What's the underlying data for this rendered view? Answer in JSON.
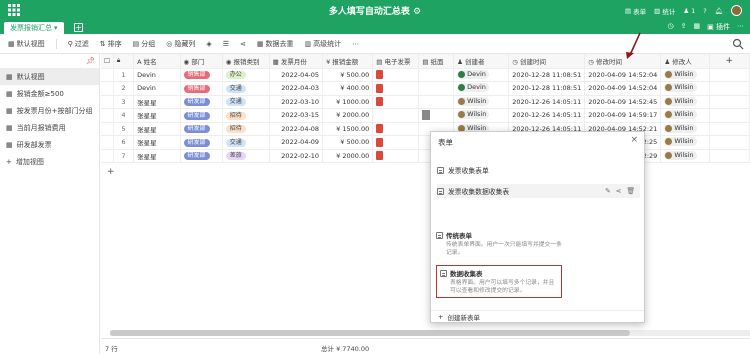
{
  "app": {
    "title": "多人填写自动汇总表",
    "title_icon": "gear-icon"
  },
  "topbar_right": {
    "form_label": "表单",
    "stats_label": "统计",
    "users_count": "1"
  },
  "tabs": [
    {
      "label": "发票报销汇总"
    }
  ],
  "tab_right": {
    "plugin_label": "插件"
  },
  "toolbar": {
    "view_label": "默认视图",
    "filter_label": "过滤",
    "sort_label": "排序",
    "group_label": "分组",
    "hidden_label": "隐藏列",
    "dedupe_label": "数据去重",
    "advanced_stats_label": "高级统计"
  },
  "sidebar": {
    "items": [
      {
        "label": "默认视图"
      },
      {
        "label": "报销金额≥500"
      },
      {
        "label": "按发票月份+按部门分组"
      },
      {
        "label": "当前月报销费用"
      },
      {
        "label": "研发部发票"
      }
    ],
    "add_label": "增加视图"
  },
  "table": {
    "columns": [
      "姓名",
      "部门",
      "报销类别",
      "发票月份",
      "报销金额",
      "电子发票",
      "纸面",
      "创建者",
      "创建时间",
      "修改时间",
      "修改人"
    ],
    "rows": [
      {
        "n": "1",
        "name": "Devin",
        "dept": "销售部",
        "cat": "办公",
        "cat_color": "#dff0c8",
        "month": "2022-04-05",
        "amount": "¥ 500.00",
        "pdf": true,
        "thumb": false,
        "creator": "Devin",
        "created": "2020-12-28 11:08:51",
        "modified": "2020-04-09 14:52:04",
        "modifier": "Wilsin"
      },
      {
        "n": "2",
        "name": "Devin",
        "dept": "销售部",
        "cat": "交通",
        "cat_color": "#cfe3fb",
        "month": "2022-04-03",
        "amount": "¥ 400.00",
        "pdf": true,
        "thumb": false,
        "creator": "Devin",
        "created": "2020-12-28 11:08:51",
        "modified": "2020-04-09 14:52:04",
        "modifier": "Wilsin"
      },
      {
        "n": "3",
        "name": "张星星",
        "dept": "研发部",
        "cat": "交通",
        "cat_color": "#cfe3fb",
        "month": "2022-03-10",
        "amount": "¥ 1000.00",
        "pdf": true,
        "thumb": false,
        "creator": "Wilsin",
        "created": "2020-12-26 14:05:11",
        "modified": "2020-04-09 14:52:45",
        "modifier": "Wilsin"
      },
      {
        "n": "4",
        "name": "张星星",
        "dept": "研发部",
        "cat": "招待",
        "cat_color": "#fde0c8",
        "month": "2022-03-15",
        "amount": "¥ 2000.00",
        "pdf": false,
        "thumb": true,
        "creator": "Wilsin",
        "created": "2020-12-26 14:05:11",
        "modified": "2020-04-09 14:59:17",
        "modifier": "Wilsin"
      },
      {
        "n": "5",
        "name": "张星星",
        "dept": "研发部",
        "cat": "招待",
        "cat_color": "#fde0c8",
        "month": "2022-04-08",
        "amount": "¥ 1500.00",
        "pdf": true,
        "thumb": false,
        "creator": "Wilsin",
        "created": "2020-12-26 14:05:11",
        "modified": "2020-04-09 14:52:21",
        "modifier": "Wilsin"
      },
      {
        "n": "6",
        "name": "张星星",
        "dept": "研发部",
        "cat": "交通",
        "cat_color": "#cfe3fb",
        "month": "2022-04-09",
        "amount": "¥ 500.00",
        "pdf": true,
        "thumb": false,
        "creator": "Wilsin",
        "created": "2020-12-26 14:05:11",
        "modified": "2020-04-09 14:52:25",
        "modifier": "Wilsin"
      },
      {
        "n": "7",
        "name": "张星星",
        "dept": "研发部",
        "cat": "差旅",
        "cat_color": "#e6d6f5",
        "month": "2022-02-10",
        "amount": "¥ 2000.00",
        "pdf": true,
        "thumb": false,
        "creator": "Wilsin",
        "created": "2020-12-26 14:05:11",
        "modified": "2020-04-09 14:52:29",
        "modifier": "Wilsin"
      }
    ]
  },
  "footer": {
    "row_count": "7 行",
    "sum": "总计 ¥ 7740.00"
  },
  "panel": {
    "title": "表单",
    "forms": [
      {
        "label": "发票收集表单"
      },
      {
        "label": "发票收集数据收集表"
      }
    ],
    "options": [
      {
        "title": "传统表单",
        "desc": "传统表单界面。用户一次只能填写并提交一条记录。"
      },
      {
        "title": "数据收集表",
        "desc": "表格界面。用户可以填写多个记录，并且可以查看和修改提交的记录。"
      }
    ],
    "create_label": "创建新表单"
  },
  "colors": {
    "brand": "#1ea362",
    "annotation": "#8b1a1a"
  }
}
